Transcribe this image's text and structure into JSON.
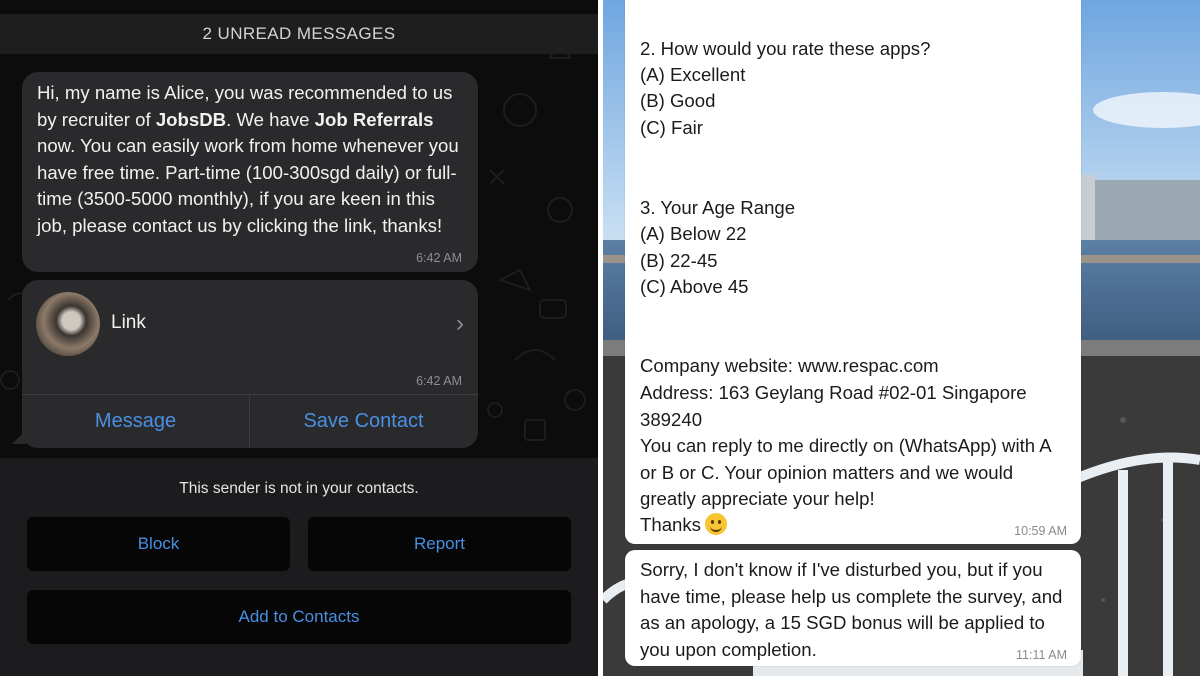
{
  "left_chat": {
    "unread_banner": "2 UNREAD MESSAGES",
    "message1": {
      "part1": "Hi, my name is Alice, you was recommended to us by recruiter of ",
      "bold1": "JobsDB",
      "part2": ". We have ",
      "bold2": "Job Referrals",
      "part3": " now. You can easily work from home whenever you have free time. Part-time (100-300sgd daily) or full-time (3500-5000 monthly), if you are keen in this job, please contact us by clicking the link, thanks!",
      "time": "6:42 AM"
    },
    "contact_card": {
      "name": "Link",
      "time": "6:42 AM",
      "message_button": "Message",
      "save_contact_button": "Save Contact"
    },
    "unknown_sender": {
      "notice": "This sender is not in your contacts.",
      "block_button": "Block",
      "report_button": "Report",
      "add_button": "Add to Contacts"
    }
  },
  "right_chat": {
    "bubble1": {
      "q2_title": "2. How would you rate these apps?",
      "q2_options": [
        "(A) Excellent",
        "(B) Good",
        "(C) Fair"
      ],
      "q3_title": "3. Your Age Range",
      "q3_options": [
        "(A) Below 22",
        "(B) 22-45",
        "(C) Above 45"
      ],
      "company_website": "Company website: www.respac.com",
      "address": "Address: 163 Geylang Road #02-01 Singapore 389240",
      "reply_text": "You can reply to me directly on (WhatsApp) with A or B or C. Your opinion matters and we would greatly appreciate your help!",
      "thanks": "Thanks",
      "time": "10:59 AM"
    },
    "bubble2": {
      "text": "Sorry, I don't know if I've disturbed you, but if you have time, please help us complete the survey, and as an apology, a 15 SGD bonus will be applied to you upon completion.",
      "time": "11:11 AM"
    }
  },
  "colors": {
    "link_blue": "#4a90e2",
    "dark_bubble": "#2a2a2c",
    "light_bubble": "#ffffff"
  },
  "icons": [
    "chevron-right-icon",
    "smiley-emoji-icon",
    "avatar-photo"
  ]
}
